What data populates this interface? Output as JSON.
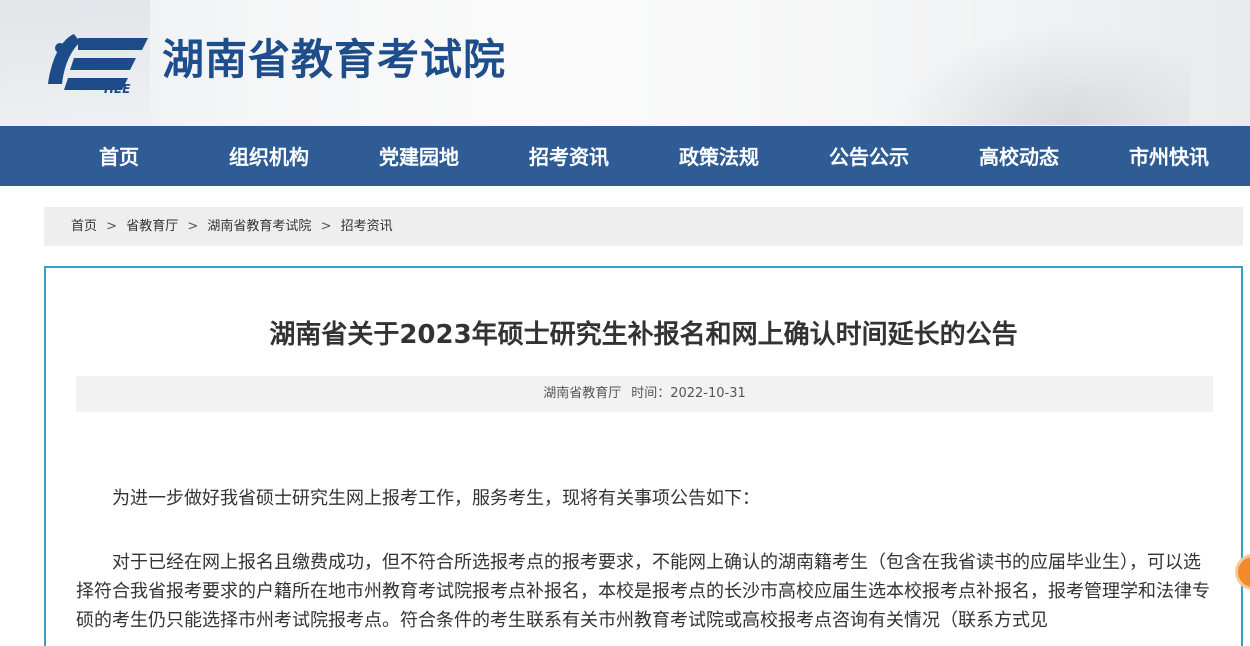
{
  "header": {
    "site_title": "湖南省教育考试院",
    "logo_caption": "HEE",
    "logo_icon": "hee-logo-icon"
  },
  "nav": {
    "items": [
      "首页",
      "组织机构",
      "党建园地",
      "招考资讯",
      "政策法规",
      "公告公示",
      "高校动态",
      "市州快讯"
    ]
  },
  "breadcrumb": {
    "items": [
      "首页",
      "省教育厅",
      "湖南省教育考试院",
      "招考资讯"
    ],
    "separator": ">"
  },
  "article": {
    "title": "湖南省关于2023年硕士研究生补报名和网上确认时间延长的公告",
    "source": "湖南省教育厅",
    "time_label": "时间：2022-10-31",
    "paragraphs": [
      "为进一步做好我省硕士研究生网上报考工作，服务考生，现将有关事项公告如下：",
      "对于已经在网上报名且缴费成功，但不符合所选报考点的报考要求，不能网上确认的湖南籍考生（包含在我省读书的应届毕业生），可以选择符合我省报考要求的户籍所在地市州教育考试院报考点补报名，本校是报考点的长沙市高校应届生选本校报考点补报名，报考管理学和法律专硕的考生仍只能选择市州考试院报考点。符合条件的考生联系有关市州教育考试院或高校报考点咨询有关情况（联系方式见"
    ]
  },
  "colors": {
    "nav_bg": "#2f5c95",
    "title_blue": "#1e4d8c",
    "article_border": "#3a9fc7",
    "float_button": "#f08a2c"
  }
}
